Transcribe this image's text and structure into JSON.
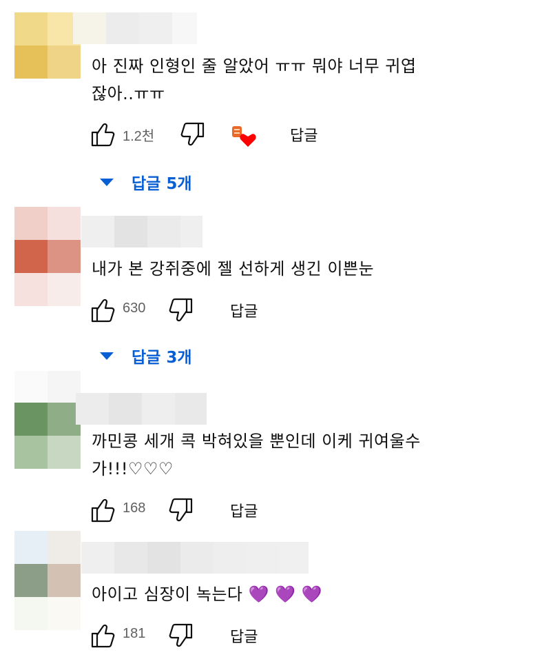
{
  "comments": [
    {
      "text": "아 진짜 인형인 줄 알았어 ㅠㅠ 뭐야 너무 귀엽\n잖아..ㅠㅠ",
      "likes": "1.2천",
      "reply_label": "답글",
      "replies_label": "답글 5개",
      "creator_heart": true
    },
    {
      "text": "내가 본 강쥐중에 젤 선하게 생긴 이쁜눈",
      "likes": "630",
      "reply_label": "답글",
      "replies_label": "답글 3개"
    },
    {
      "text": "까민콩 세개 콕 박혀있을 뿐인데 이케 귀여울수\n가!!!♡♡♡",
      "likes": "168",
      "reply_label": "답글"
    },
    {
      "text": "아이고 심장이 녹는다 💜 💜 💜",
      "likes": "181",
      "reply_label": "답글"
    }
  ],
  "colors": {
    "link_blue": "#065fd4",
    "muted_text": "#606060",
    "heart_red": "#ff0000"
  },
  "icons": [
    "like-icon",
    "dislike-icon",
    "creator-heart-icon",
    "caret-down-icon"
  ]
}
